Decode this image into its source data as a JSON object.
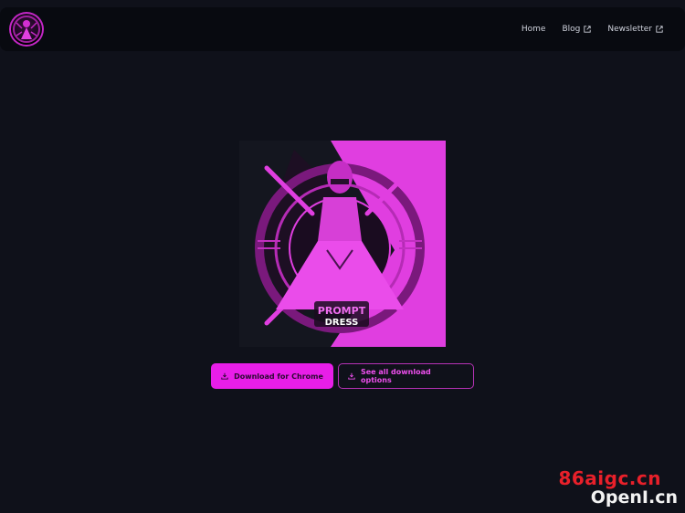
{
  "header": {
    "logo_icon": "prompt-dress-logo-icon",
    "nav": [
      {
        "label": "Home",
        "external": false
      },
      {
        "label": "Blog",
        "external": true
      },
      {
        "label": "Newsletter",
        "external": true
      }
    ]
  },
  "hero": {
    "image_text_line1": "PROMPT",
    "image_text_line2": "DRESS",
    "colors": {
      "magenta": "#e81ee8",
      "dark": "#14161f"
    }
  },
  "actions": {
    "primary_label": "Download for Chrome",
    "secondary_label": "See all download options",
    "icon": "download-icon"
  },
  "watermark": {
    "line1": "86aigc.cn",
    "line2": "OpenI.cn"
  }
}
